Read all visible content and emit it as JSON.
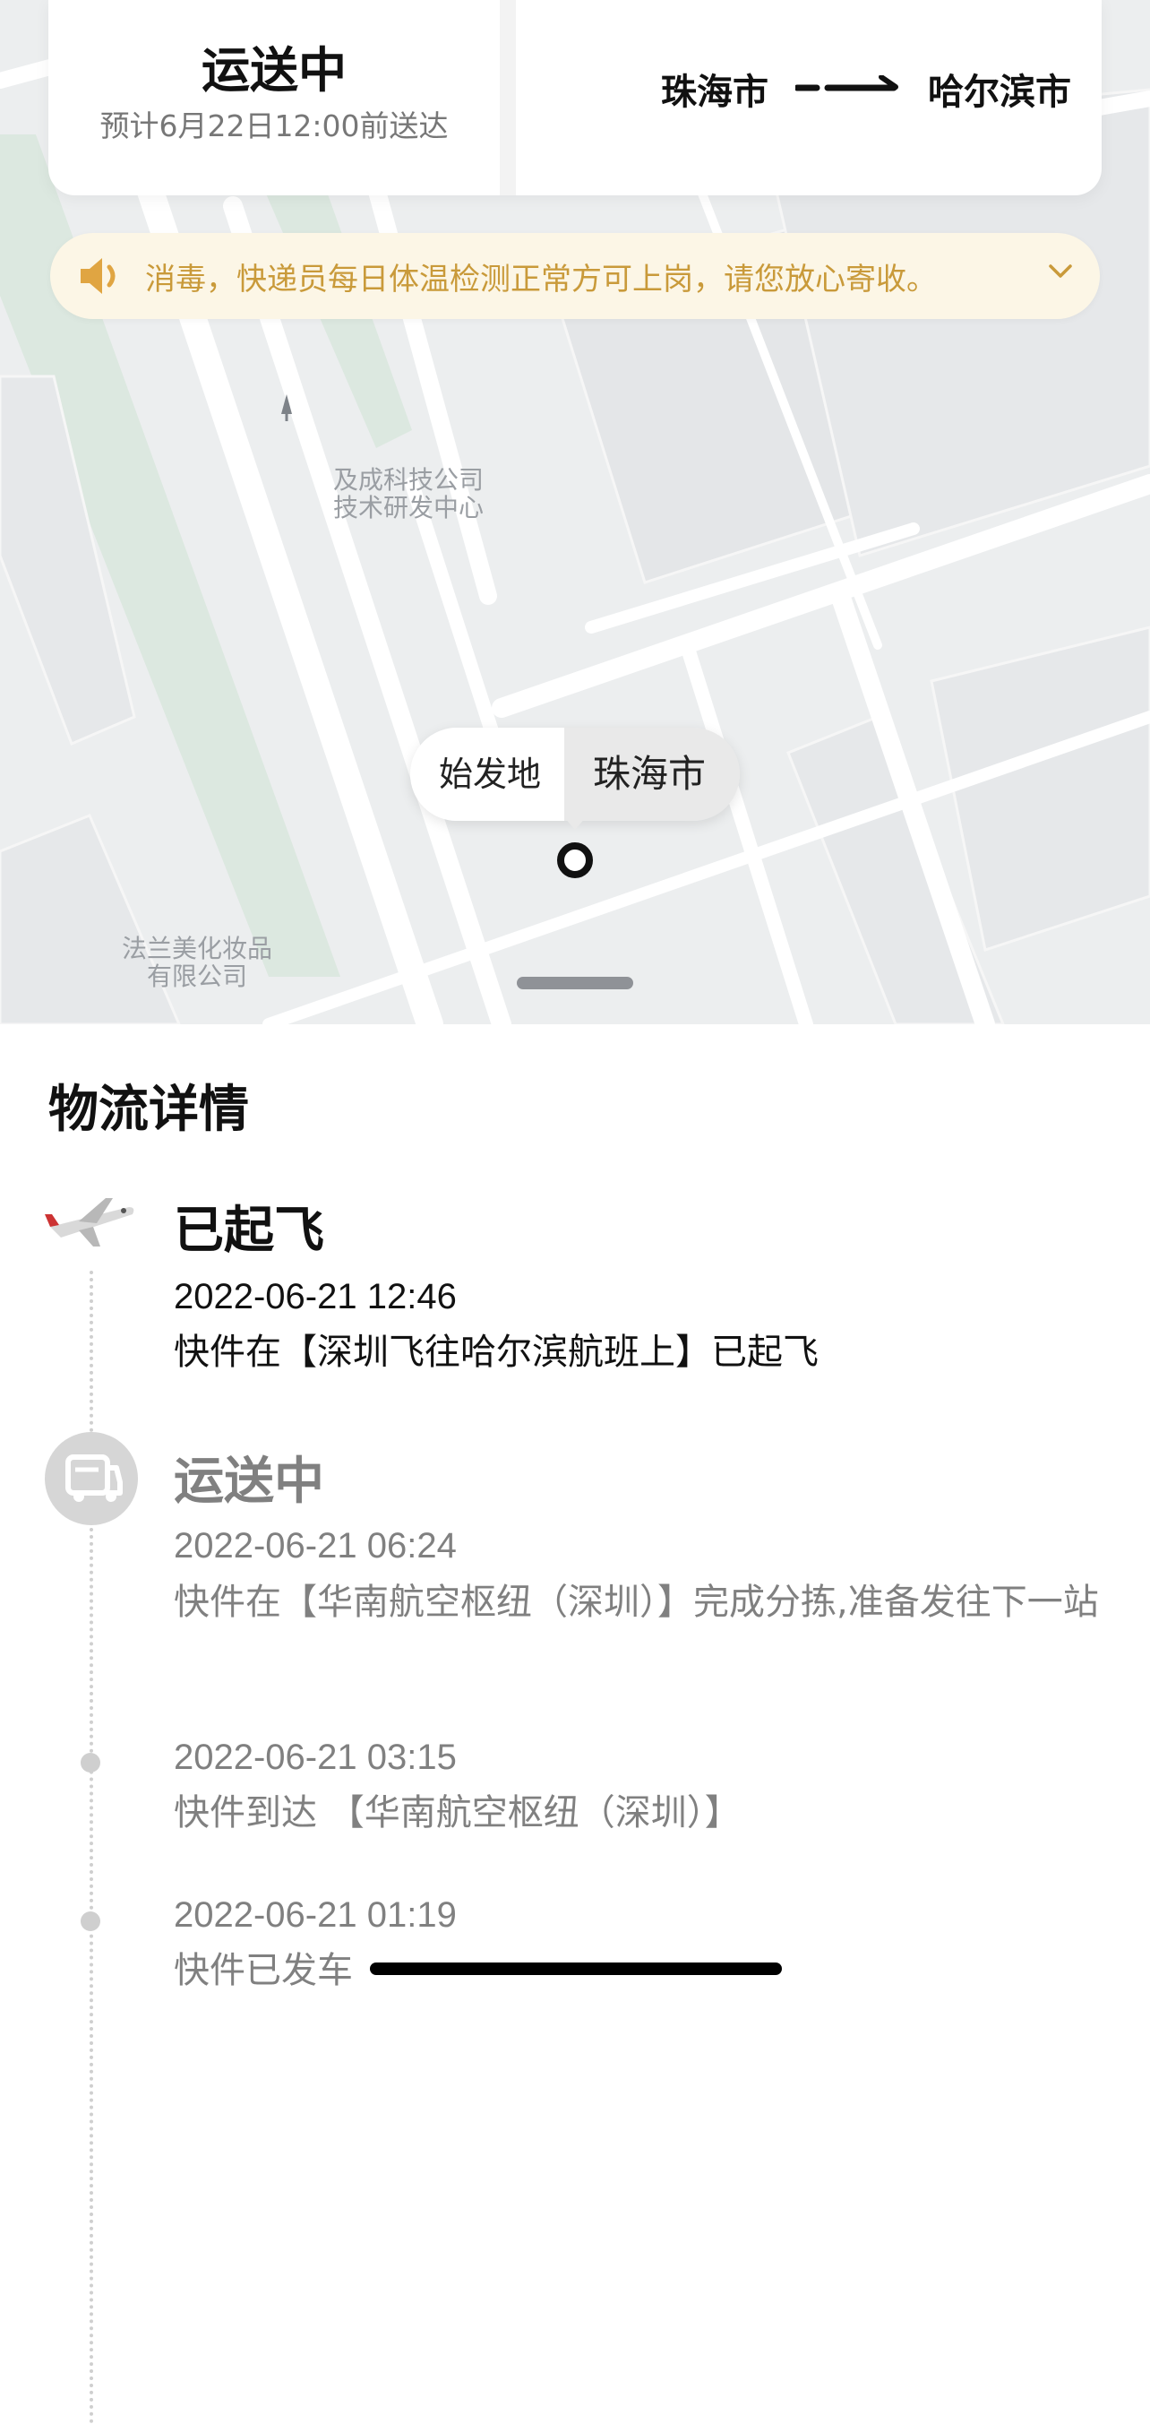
{
  "header": {
    "status": "运送中",
    "eta": "预计6月22日12:00前送达",
    "from_city": "珠海市",
    "to_city": "哈尔滨市"
  },
  "notice": {
    "text": "消毒，快递员每日体温检测正常方可上岗，请您放心寄收。"
  },
  "map": {
    "poi": [
      {
        "line1": "及成科技公司",
        "line2": "技术研发中心"
      },
      {
        "line1": "法兰美化妆品",
        "line2": "有限公司"
      }
    ],
    "pin": {
      "label": "始发地",
      "city": "珠海市"
    }
  },
  "details": {
    "title": "物流详情",
    "events": [
      {
        "title": "已起飞",
        "time": "2022-06-21 12:46",
        "desc": "快件在【深圳飞往哈尔滨航班上】已起飞"
      },
      {
        "title": "运送中",
        "time": "2022-06-21 06:24",
        "desc": "快件在【华南航空枢纽（深圳）】完成分拣,准备发往下一站"
      },
      {
        "title": "",
        "time": "2022-06-21 03:15",
        "desc": "快件到达 【华南航空枢纽（深圳）】"
      },
      {
        "title": "",
        "time": "2022-06-21 01:19",
        "desc": "快件已发车"
      }
    ]
  },
  "colors": {
    "notice_bg": "#fcf6e6",
    "notice_text": "#c99a3a",
    "map_bg": "#eceeef",
    "map_green": "#dbe9e1"
  },
  "icons": [
    "route-arrow-icon",
    "speaker-icon",
    "chevron-down-icon",
    "plane-icon",
    "truck-icon"
  ]
}
